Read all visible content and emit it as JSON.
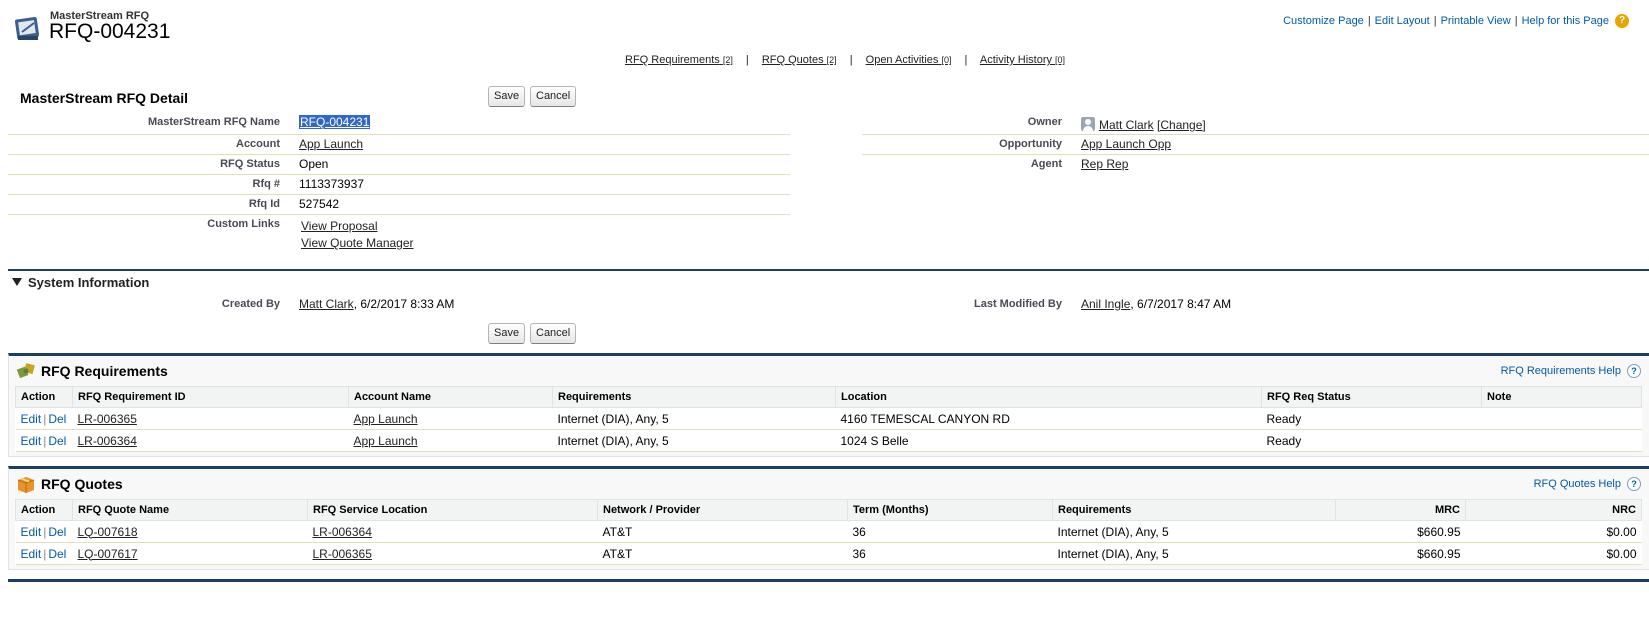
{
  "header": {
    "object_type": "MasterStream RFQ",
    "record_name": "RFQ-004231",
    "links": [
      "Customize Page",
      "Edit Layout",
      "Printable View",
      "Help for this Page"
    ],
    "help_icon": "?"
  },
  "related_bar": [
    {
      "label": "RFQ Requirements",
      "count": "[2]"
    },
    {
      "label": "RFQ Quotes",
      "count": "[2]"
    },
    {
      "label": "Open Activities",
      "count": "[0]"
    },
    {
      "label": "Activity History",
      "count": "[0]"
    }
  ],
  "detail": {
    "title": "MasterStream RFQ Detail",
    "save_label": "Save",
    "cancel_label": "Cancel",
    "fields_left": [
      {
        "label": "MasterStream RFQ Name",
        "value": "RFQ-004231"
      },
      {
        "label": "Account",
        "value": "App Launch"
      },
      {
        "label": "RFQ Status",
        "value": "Open"
      },
      {
        "label": "Rfq #",
        "value": "1113373937"
      },
      {
        "label": "Rfq Id",
        "value": "527542"
      },
      {
        "label": "Custom Links",
        "links": [
          "View Proposal",
          "View Quote Manager"
        ]
      }
    ],
    "fields_right": [
      {
        "label": "Owner",
        "value": "Matt Clark",
        "extra": "[Change]"
      },
      {
        "label": "Opportunity",
        "value": "App Launch Opp"
      },
      {
        "label": "Agent",
        "value": "Rep Rep"
      }
    ]
  },
  "system_info": {
    "title": "System Information",
    "created_by_label": "Created By",
    "created_by_user": "Matt Clark",
    "created_by_date": ", 6/2/2017 8:33 AM",
    "modified_by_label": "Last Modified By",
    "modified_by_user": "Anil Ingle",
    "modified_by_date": ", 6/7/2017 8:47 AM"
  },
  "requirements": {
    "title": "RFQ Requirements",
    "help": "RFQ Requirements Help",
    "columns": [
      "Action",
      "RFQ Requirement ID",
      "Account Name",
      "Requirements",
      "Location",
      "RFQ Req Status",
      "Note"
    ],
    "rows": [
      {
        "edit": "Edit",
        "del": "Del",
        "id": "LR-006365",
        "account": "App Launch",
        "req": "Internet (DIA), Any, 5",
        "location": "4160 TEMESCAL CANYON RD",
        "status": "Ready",
        "note": ""
      },
      {
        "edit": "Edit",
        "del": "Del",
        "id": "LR-006364",
        "account": "App Launch",
        "req": "Internet (DIA), Any, 5",
        "location": "1024 S Belle",
        "status": "Ready",
        "note": ""
      }
    ]
  },
  "quotes": {
    "title": "RFQ Quotes",
    "help": "RFQ Quotes Help",
    "columns": [
      "Action",
      "RFQ Quote Name",
      "RFQ Service Location",
      "Network / Provider",
      "Term (Months)",
      "Requirements",
      "MRC",
      "NRC"
    ],
    "rows": [
      {
        "edit": "Edit",
        "del": "Del",
        "name": "LQ-007618",
        "location": "LR-006364",
        "provider": "AT&T",
        "term": "36",
        "req": "Internet (DIA), Any, 5",
        "mrc": "$660.95",
        "nrc": "$0.00"
      },
      {
        "edit": "Edit",
        "del": "Del",
        "name": "LQ-007617",
        "location": "LR-006365",
        "provider": "AT&T",
        "term": "36",
        "req": "Internet (DIA), Any, 5",
        "mrc": "$660.95",
        "nrc": "$0.00"
      }
    ]
  },
  "colors": {
    "brand_bar": "#1d3e63",
    "link": "#015ba7",
    "selection": "#3067c9"
  }
}
